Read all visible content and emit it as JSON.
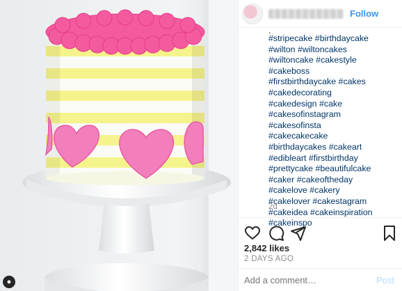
{
  "post": {
    "photo_icon": "person-badge-icon",
    "follow_label": "Follow",
    "caption_tags": [
      "#stripecake #birthdaycake",
      "#wilton #wiltoncakes",
      "#wiltoncake #cakestyle",
      "#cakeboss",
      "#firstbirthdaycake #cakes",
      "#cakedecorating",
      "#cakedesign #cake",
      "#cakesofinstagram",
      "#cakesofinsta",
      "#cakecakecake",
      "#birthdaycakes #cakeart",
      "#edibleart #firstbirthday",
      "#prettycake #beautifulcake",
      "#caker #cakeoftheday",
      "#cakelove #cakery",
      "#cakelover #cakestagram",
      "#cakeidea #cakeinspiration",
      "#cakeinspo"
    ],
    "time_short": "2d",
    "likes": "2,842 likes",
    "date": "2 DAYS AGO",
    "comment_placeholder": "Add a comment…",
    "post_label": "Post"
  },
  "icons": {
    "like": "heart-icon",
    "comment": "comment-icon",
    "share": "share-icon",
    "save": "bookmark-icon"
  },
  "colors": {
    "link": "#3897f0",
    "hashtag": "#003569",
    "muted": "#8e8e8e",
    "frosting_pink": "#f2559b",
    "stripe_yellow": "#f4f28a"
  }
}
